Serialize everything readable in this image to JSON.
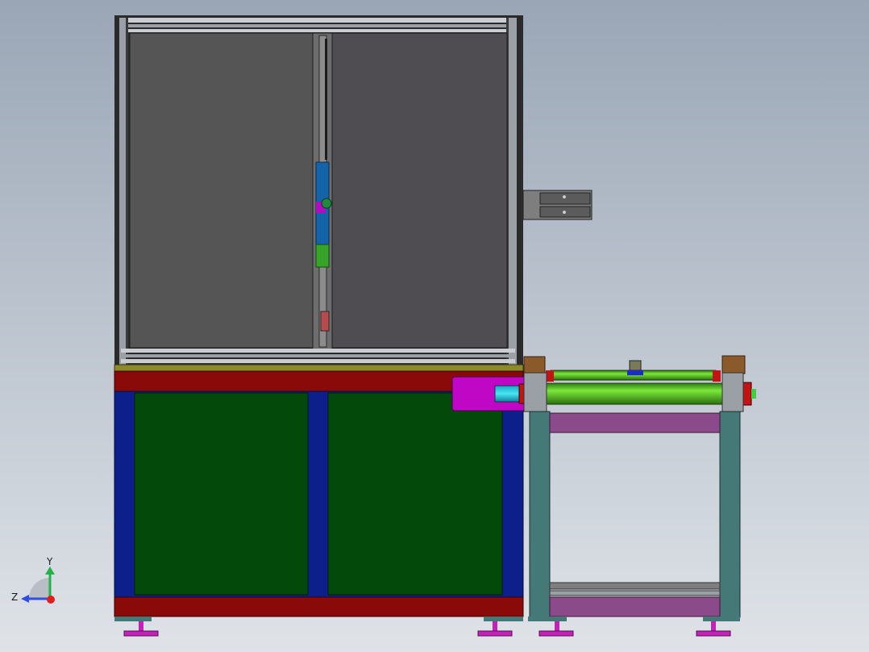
{
  "viewport": {
    "background_top": "#9aa6b6",
    "background_bottom": "#dfe3e8"
  },
  "triad": {
    "y_label": "Y",
    "z_label": "Z",
    "y_color": "#22b24c",
    "z_color": "#2f4fe0",
    "x_color": "#e01e1e"
  },
  "colors": {
    "frame_dark": "#2b2b2b",
    "frame_gray": "#9aa0a6",
    "panel_gray": "#555555",
    "panel_gray_right": "#4f4d52",
    "base_red": "#8a0a0a",
    "base_yellow": "#8d8a2a",
    "cabinet_blue": "#0c1f8a",
    "cabinet_green": "#034a0a",
    "motor_magenta": "#c007c6",
    "roller_green": "#4fc820",
    "stand_teal": "#447978",
    "stand_purple": "#8b4a8a",
    "foot_magenta": "#c322b8"
  }
}
